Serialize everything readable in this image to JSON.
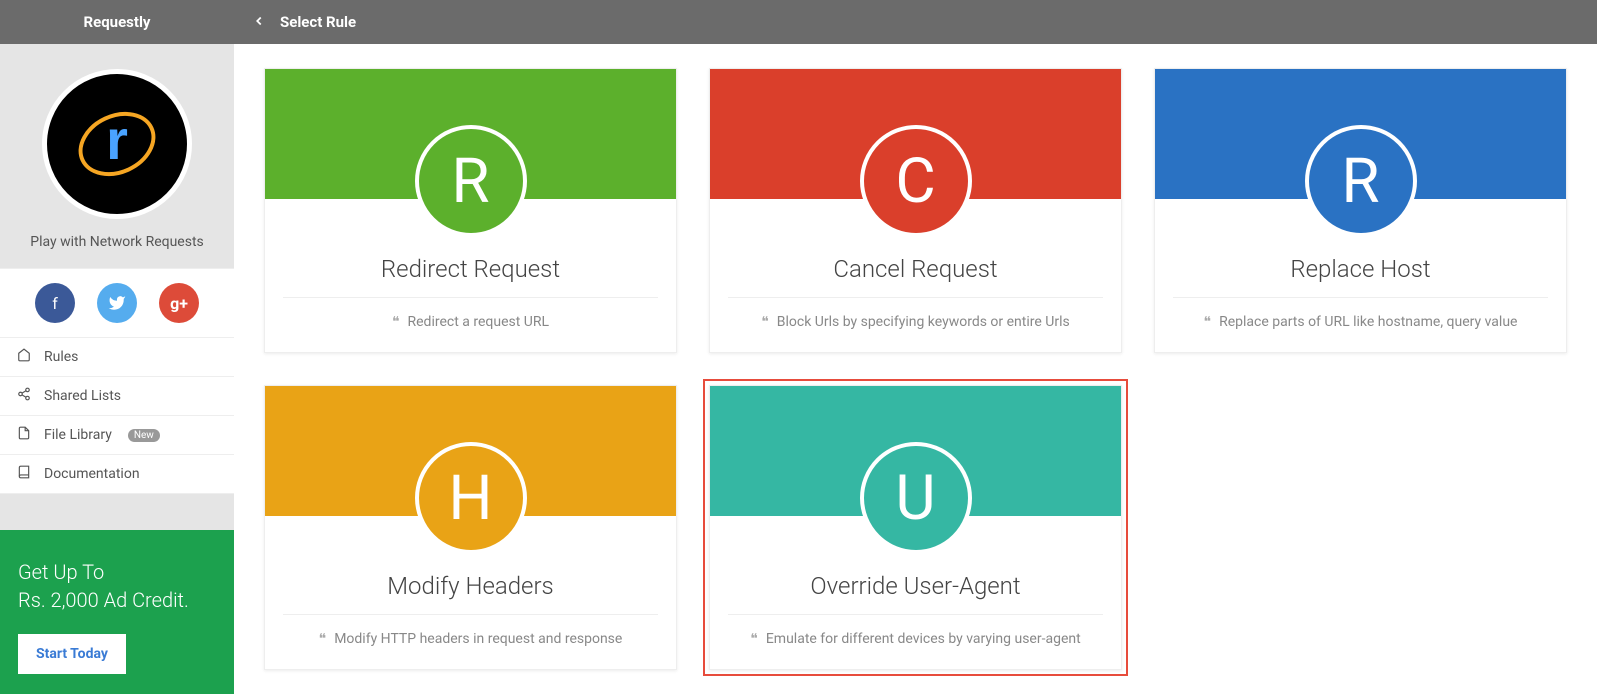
{
  "sidebar": {
    "app_name": "Requestly",
    "tagline": "Play with Network Requests",
    "nav": [
      {
        "icon": "home",
        "label": "Rules"
      },
      {
        "icon": "share",
        "label": "Shared Lists"
      },
      {
        "icon": "file",
        "label": "File Library",
        "badge": "New"
      },
      {
        "icon": "book",
        "label": "Documentation"
      }
    ],
    "promo": {
      "line1": "Get Up To",
      "line2": "Rs. 2,000 Ad Credit.",
      "cta": "Start Today"
    }
  },
  "topbar": {
    "title": "Select Rule"
  },
  "cards": [
    {
      "letter": "R",
      "color": "green",
      "title": "Redirect Request",
      "desc": "Redirect a request URL",
      "highlight": false
    },
    {
      "letter": "C",
      "color": "red",
      "title": "Cancel Request",
      "desc": "Block Urls by specifying keywords or entire Urls",
      "highlight": false
    },
    {
      "letter": "R",
      "color": "blue",
      "title": "Replace Host",
      "desc": "Replace parts of URL like hostname, query value",
      "highlight": false
    },
    {
      "letter": "H",
      "color": "orange",
      "title": "Modify Headers",
      "desc": "Modify HTTP headers in request and response",
      "highlight": false
    },
    {
      "letter": "U",
      "color": "teal",
      "title": "Override User-Agent",
      "desc": "Emulate for different devices by varying user-agent",
      "highlight": true
    }
  ]
}
